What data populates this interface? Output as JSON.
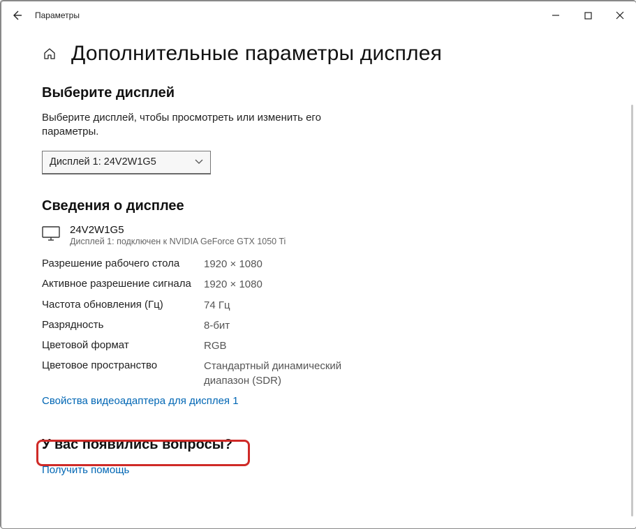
{
  "titlebar": {
    "app_title": "Параметры"
  },
  "page": {
    "title": "Дополнительные параметры дисплея"
  },
  "select_display": {
    "heading": "Выберите дисплей",
    "description": "Выберите дисплей, чтобы просмотреть или изменить его параметры.",
    "selected": "Дисплей 1: 24V2W1G5"
  },
  "display_info": {
    "heading": "Сведения о дисплее",
    "name": "24V2W1G5",
    "subline": "Дисплей 1: подключен к NVIDIA GeForce GTX 1050 Ti",
    "rows": [
      {
        "label": "Разрешение рабочего стола",
        "value": "1920 × 1080"
      },
      {
        "label": "Активное разрешение сигнала",
        "value": "1920 × 1080"
      },
      {
        "label": "Частота обновления (Гц)",
        "value": "74 Гц"
      },
      {
        "label": "Разрядность",
        "value": "8-бит"
      },
      {
        "label": "Цветовой формат",
        "value": "RGB"
      },
      {
        "label": "Цветовое пространство",
        "value": "Стандартный динамический диапазон (SDR)"
      }
    ],
    "adapter_link": "Свойства видеоадаптера для дисплея 1"
  },
  "help": {
    "heading": "У вас появились вопросы?",
    "link": "Получить помощь"
  }
}
